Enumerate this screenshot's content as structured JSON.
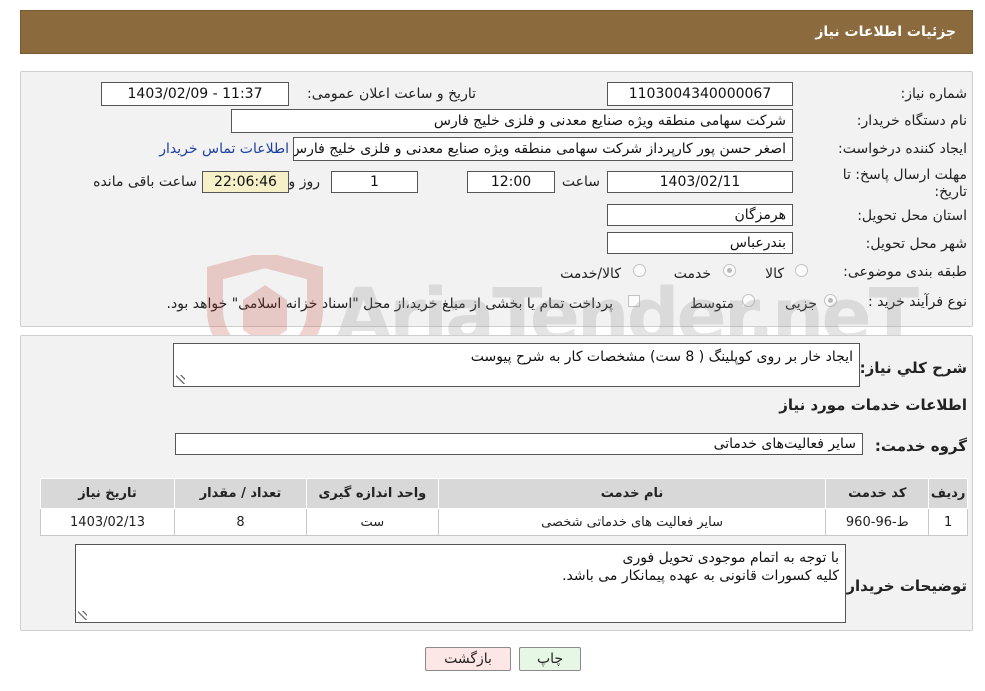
{
  "header": {
    "title": "جزئیات اطلاعات نیاز"
  },
  "details": {
    "need_number_label": "شماره نیاز:",
    "need_number": "1103004340000067",
    "announce_label": "تاریخ و ساعت اعلان عمومی:",
    "announce_value": "1403/02/09 - 11:37",
    "buyer_org_label": "نام دستگاه خریدار:",
    "buyer_org": "شرکت سهامی منطقه ویژه صنایع معدنی و فلزی خلیج فارس",
    "requester_label": "ایجاد کننده درخواست:",
    "requester": "اصغر حسن پور کارپرداز شرکت سهامی منطقه ویژه صنایع معدنی و فلزی خلیج فارس",
    "contact_link": "اطلاعات تماس خریدار",
    "deadline_label_line1": "مهلت ارسال پاسخ: تا",
    "deadline_label_line2": "تاریخ:",
    "deadline_date": "1403/02/11",
    "time_label": "ساعت",
    "deadline_time": "12:00",
    "days_value": "1",
    "days_label": "روز و",
    "remaining_time": "22:06:46",
    "remaining_label": "ساعت باقی مانده",
    "province_label": "استان محل تحویل:",
    "province": "هرمزگان",
    "city_label": "شهر محل تحویل:",
    "city": "بندرعباس",
    "category_label": "طبقه بندی موضوعی:",
    "category_options": [
      "کالا",
      "خدمت",
      "کالا/خدمت"
    ],
    "process_label": "نوع فرآیند خرید :",
    "process_options": [
      "جزیی",
      "متوسط"
    ],
    "payment_note": "پرداخت تمام یا بخشی از مبلغ خرید،از محل \"اسناد خزانه اسلامی\" خواهد بود."
  },
  "summary": {
    "label": "شرح کلي نياز:",
    "text": "ایجاد خار بر روی کوپلینگ ( 8 ست) مشخصات کار به شرح پیوست"
  },
  "services": {
    "section_title": "اطلاعات خدمات مورد نیاز",
    "group_label": "گروه خدمت:",
    "group_value": "سایر فعالیت‌های خدماتی",
    "columns": [
      "ردیف",
      "کد خدمت",
      "نام خدمت",
      "واحد اندازه گیری",
      "تعداد / مقدار",
      "تاریخ نیاز"
    ],
    "rows": [
      [
        "1",
        "ط-96-960",
        "سایر فعالیت های خدماتی شخصی",
        "ست",
        "8",
        "1403/02/13"
      ]
    ]
  },
  "buyer_notes": {
    "label": "توضیحات خریدار:",
    "line1": "با توجه به اتمام موجودی تحویل فوری",
    "line2": "کلیه کسورات قانونی به عهده پیمانکار می باشد."
  },
  "buttons": {
    "print": "چاپ",
    "back": "بازگشت"
  },
  "watermark": {
    "text": "AriaTender.neT"
  },
  "colors": {
    "header_bg": "#8b6a3e",
    "link": "#1b3fa0",
    "back_button": "#fde6e6",
    "print_button": "#e6f7e6"
  }
}
